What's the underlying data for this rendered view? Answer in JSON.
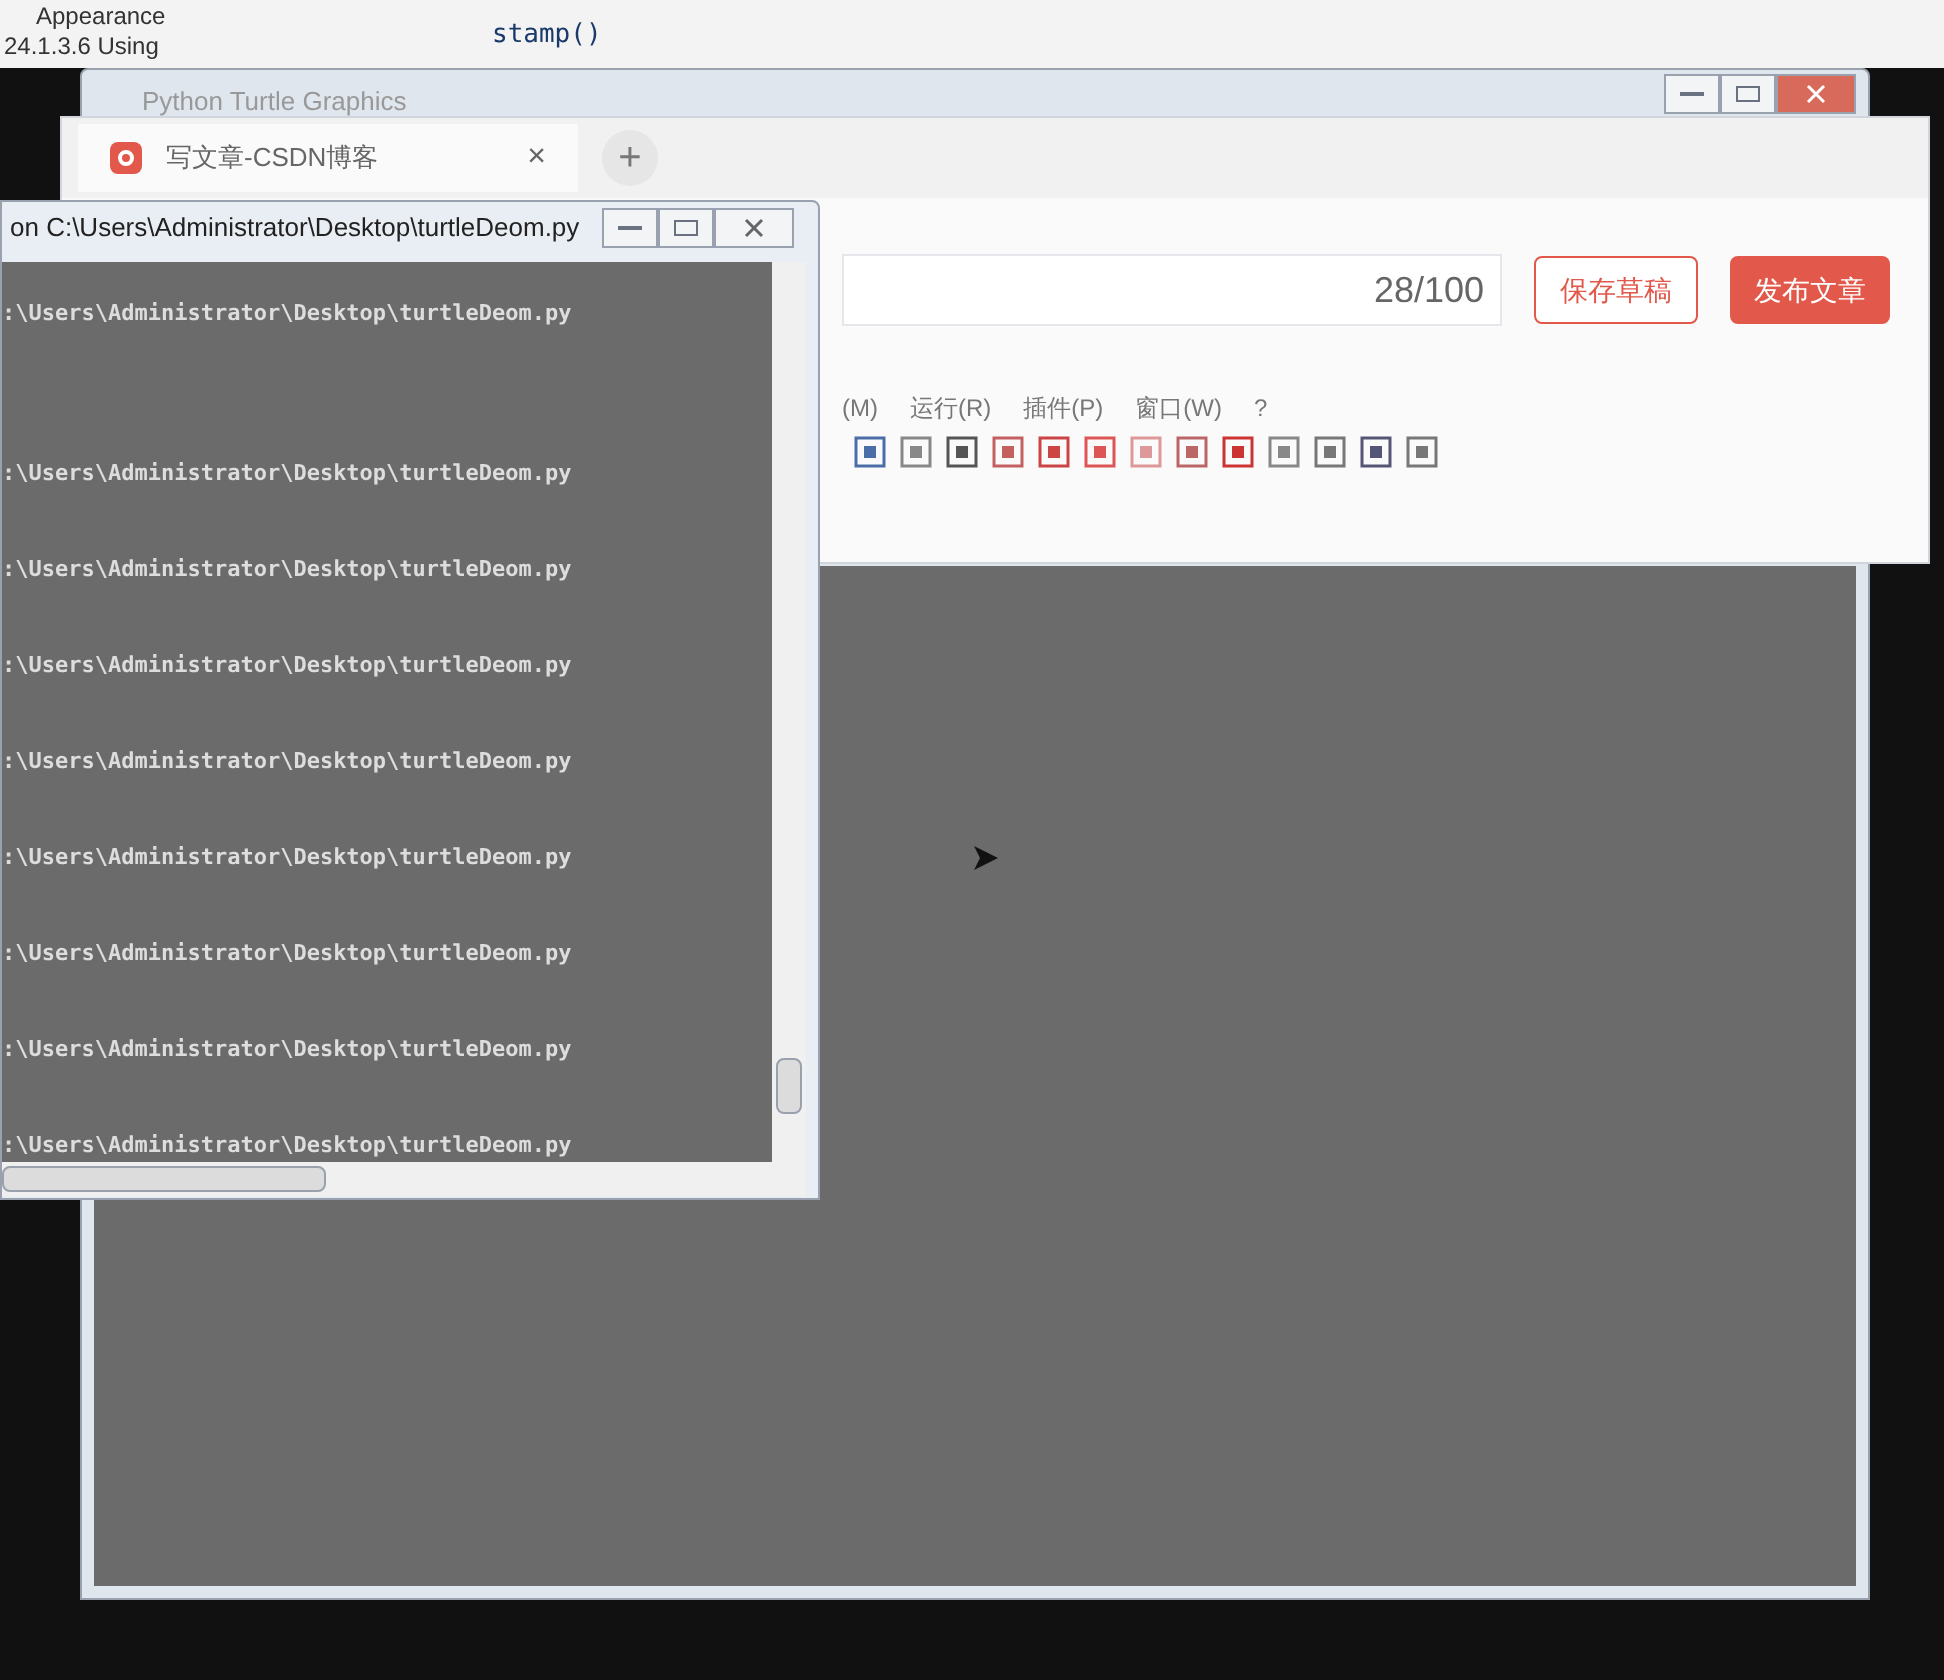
{
  "background_window": {
    "sidebar_texts": [
      "Appearance",
      "24.1.3.6  Using"
    ],
    "code_line": "stamp()"
  },
  "turtle_window": {
    "title": "Python Turtle Graphics"
  },
  "browser": {
    "tab": {
      "close": "×",
      "title": "写文章-CSDN博客",
      "selected": true
    },
    "new_tab": "+",
    "title_count": "28/100",
    "save_button": "保存草稿",
    "publish_button": "发布文章"
  },
  "editor": {
    "menu": [
      {
        "label": "(M)"
      },
      {
        "label": "运行(R)"
      },
      {
        "label": "插件(P)"
      },
      {
        "label": "窗口(W)"
      },
      {
        "label": "?"
      }
    ]
  },
  "console": {
    "title": "on  C:\\Users\\Administrator\\Desktop\\turtleDeom.py",
    "lines": [
      ":\\Users\\Administrator\\Desktop\\turtleDeom.py",
      ":\\Users\\Administrator\\Desktop\\turtleDeom.py",
      ":\\Users\\Administrator\\Desktop\\turtleDeom.py",
      ":\\Users\\Administrator\\Desktop\\turtleDeom.py",
      ":\\Users\\Administrator\\Desktop\\turtleDeom.py",
      ":\\Users\\Administrator\\Desktop\\turtleDeom.py",
      ":\\Users\\Administrator\\Desktop\\turtleDeom.py",
      ":\\Users\\Administrator\\Desktop\\turtleDeom.py",
      ":\\Users\\Administrator\\Desktop\\turtleDeom.py"
    ]
  }
}
